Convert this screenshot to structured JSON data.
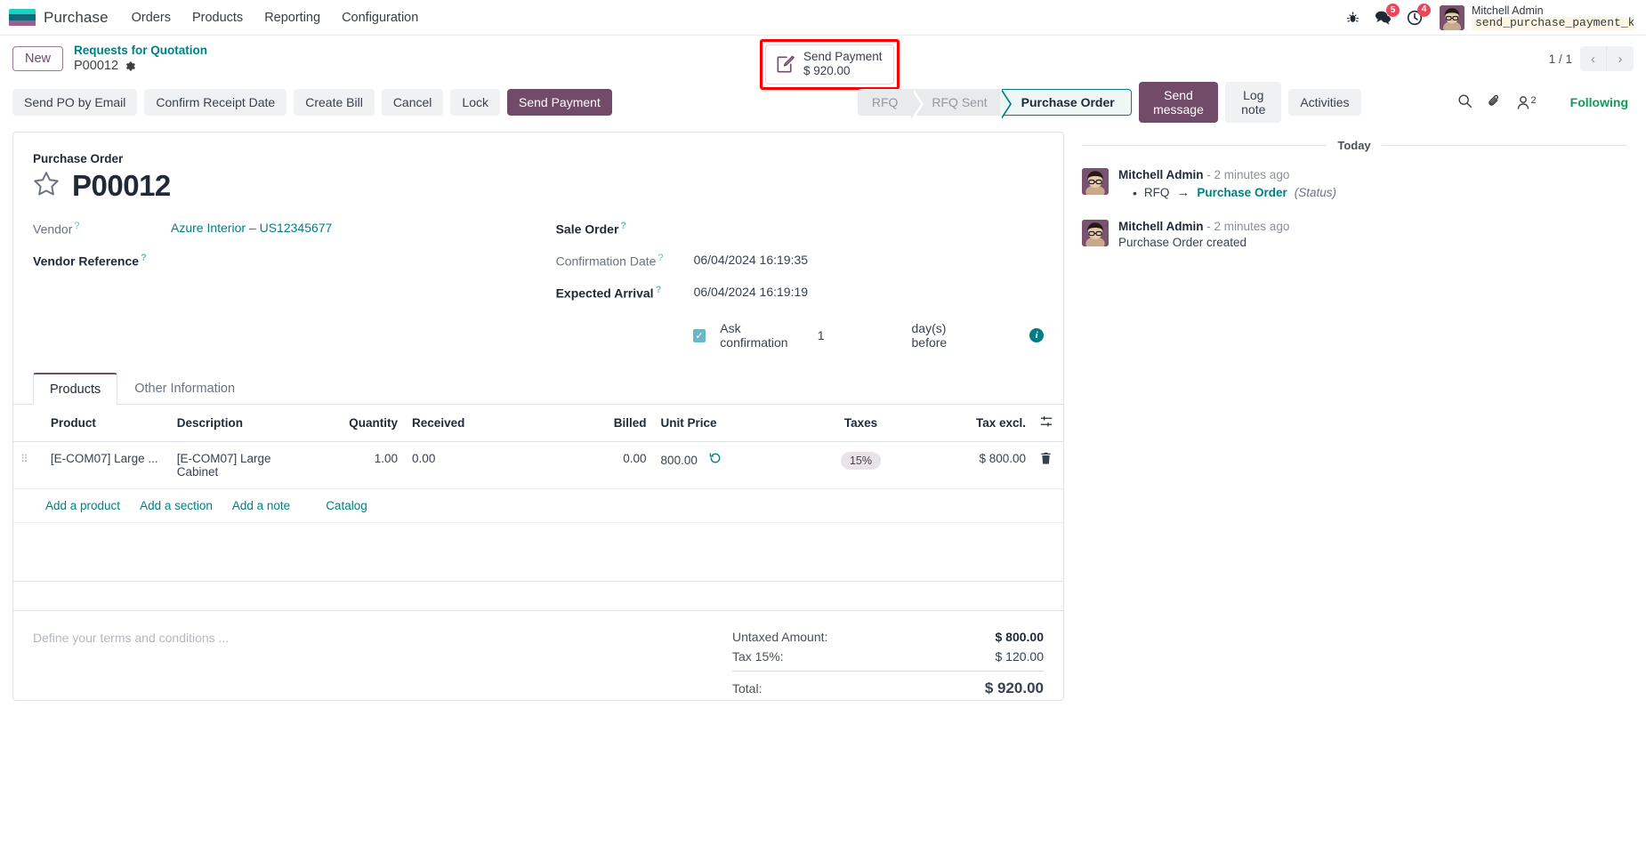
{
  "navbar": {
    "app_name": "Purchase",
    "menu": [
      "Orders",
      "Products",
      "Reporting",
      "Configuration"
    ],
    "bug_icon": "bug-icon",
    "messages_icon": "messages-icon",
    "messages_count": "5",
    "activities_icon": "clock-icon",
    "activities_count": "4",
    "user_name": "Mitchell Admin",
    "user_db": "send_purchase_payment_kn…",
    "db_icon": "database-icon"
  },
  "control_panel": {
    "new_label": "New",
    "breadcrumb_parent": "Requests for Quotation",
    "breadcrumb_current": "P00012",
    "gear_icon": "gear-icon",
    "smart_button": {
      "icon": "payment-edit-icon",
      "line1": "Send Payment",
      "line2": "$ 920.00",
      "highlight_color": "#ff0000"
    },
    "pager": "1 / 1",
    "prev_icon": "chevron-left-icon",
    "next_icon": "chevron-right-icon"
  },
  "action_bar": {
    "buttons": [
      {
        "label": "Send PO by Email",
        "primary": false
      },
      {
        "label": "Confirm Receipt Date",
        "primary": false
      },
      {
        "label": "Create Bill",
        "primary": false
      },
      {
        "label": "Cancel",
        "primary": false
      },
      {
        "label": "Lock",
        "primary": false
      },
      {
        "label": "Send Payment",
        "primary": true
      }
    ],
    "stages": [
      {
        "label": "RFQ",
        "active": false
      },
      {
        "label": "RFQ Sent",
        "active": false
      },
      {
        "label": "Purchase Order",
        "active": true
      }
    ],
    "stage_active_color": "#017e84"
  },
  "chatter_toolbar": {
    "send_message": "Send message",
    "log_note": "Log note",
    "activities": "Activities",
    "search_icon": "search-icon",
    "attachment_icon": "paperclip-icon",
    "followers_icon": "user-icon",
    "followers_count": "2",
    "following_label": "Following",
    "following_color": "#0f9d58"
  },
  "form": {
    "sheet_title": "Purchase Order",
    "star_icon": "star-icon",
    "record_id": "P00012",
    "left_fields": [
      {
        "label": "Vendor",
        "value": "Azure Interior – US12345677",
        "required": false,
        "link": true,
        "help": "?"
      },
      {
        "label": "Vendor Reference",
        "value": "",
        "required": true,
        "link": false,
        "help": "?"
      }
    ],
    "right_fields": [
      {
        "label": "Sale Order",
        "value": "",
        "required": true,
        "help": "?"
      },
      {
        "label": "Confirmation Date",
        "value": "06/04/2024 16:19:35",
        "required": false,
        "help": "?"
      },
      {
        "label": "Expected Arrival",
        "value": "06/04/2024 16:19:19",
        "required": true,
        "help": "?"
      }
    ],
    "ask_confirmation": {
      "checked": true,
      "check_icon": "checkmark-icon",
      "label": "Ask confirmation",
      "days": "1",
      "suffix": "day(s) before",
      "info_icon": "info-icon"
    },
    "tabs": [
      {
        "label": "Products",
        "active": true
      },
      {
        "label": "Other Information",
        "active": false
      }
    ],
    "table": {
      "columns": [
        "Product",
        "Description",
        "Quantity",
        "Received",
        "Billed",
        "Unit Price",
        "Taxes",
        "Tax excl."
      ],
      "optional_columns_icon": "adjust-columns-icon",
      "rows": [
        {
          "drag_handle": "drag-handle-icon",
          "product": "[E-COM07] Large ...",
          "description": "[E-COM07] Large Cabinet",
          "quantity": "1.00",
          "received": "0.00",
          "billed": "0.00",
          "unit_price": "800.00",
          "history_icon": "price-history-icon",
          "taxes": "15%",
          "tax_excl": "$ 800.00",
          "delete_icon": "trash-icon"
        }
      ],
      "add_links": [
        "Add a product",
        "Add a section",
        "Add a note",
        "Catalog"
      ]
    },
    "terms_placeholder": "Define your terms and conditions ...",
    "totals": [
      {
        "label": "Untaxed Amount:",
        "amount": "$ 800.00",
        "kind": "untaxed"
      },
      {
        "label": "Tax 15%:",
        "amount": "$ 120.00",
        "kind": "tax"
      },
      {
        "label": "Total:",
        "amount": "$ 920.00",
        "kind": "total"
      }
    ]
  },
  "chatter": {
    "day_separator": "Today",
    "messages": [
      {
        "author": "Mitchell Admin",
        "time": "- 2 minutes ago",
        "tracking": {
          "old": "RFQ",
          "arrow": "→",
          "new": "Purchase Order",
          "field": "(Status)"
        },
        "body": ""
      },
      {
        "author": "Mitchell Admin",
        "time": "- 2 minutes ago",
        "tracking": null,
        "body": "Purchase Order created"
      }
    ]
  },
  "colors": {
    "brand_purple": "#714B67",
    "teal": "#017e84",
    "logo_bar1": "#1ccfc0",
    "logo_bar2": "#0f6b78",
    "logo_bar3": "#9b5f8f"
  }
}
